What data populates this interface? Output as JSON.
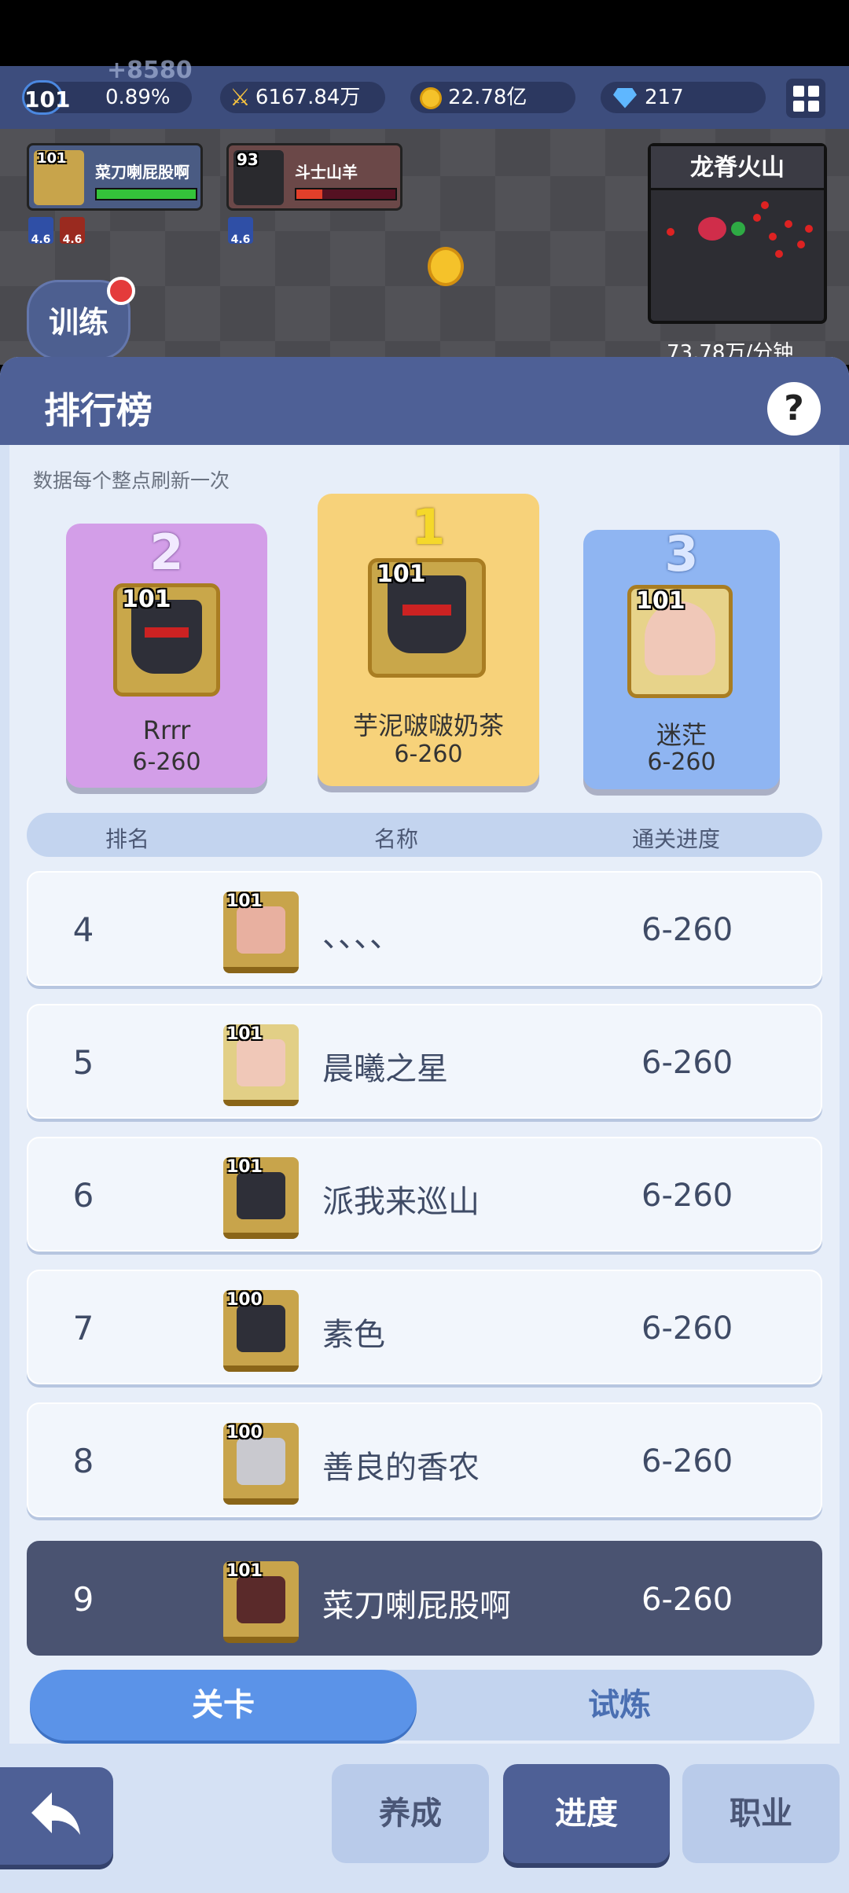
{
  "hud": {
    "level": "101",
    "float_gain": "+8580",
    "exp_percent": "0.89%",
    "power": "6167.84万",
    "gold": "22.78亿",
    "gems": "217"
  },
  "battle": {
    "ally_level": "101",
    "ally_name": "菜刀喇屁股啊",
    "enemy_level": "93",
    "enemy_name": "斗士山羊",
    "buffs": [
      "4.6",
      "4.6"
    ],
    "enemy_buff": "4.6",
    "train_label": "训练",
    "map_name": "龙脊火山",
    "rate": "73.78万/分钟"
  },
  "ranking": {
    "title": "排行榜",
    "help": "?",
    "refresh_note": "数据每个整点刷新一次",
    "podium": [
      {
        "rank": "1",
        "level": "101",
        "name": "芋泥啵啵奶茶",
        "progress": "6-260"
      },
      {
        "rank": "2",
        "level": "101",
        "name": "Rrrr",
        "progress": "6-260"
      },
      {
        "rank": "3",
        "level": "101",
        "name": "迷茫",
        "progress": "6-260"
      }
    ],
    "columns": {
      "rank": "排名",
      "name": "名称",
      "progress": "通关进度"
    },
    "rows": [
      {
        "rank": "4",
        "level": "101",
        "name": "、、、、",
        "progress": "6-260"
      },
      {
        "rank": "5",
        "level": "101",
        "name": "晨曦之星",
        "progress": "6-260"
      },
      {
        "rank": "6",
        "level": "101",
        "name": "派我来巡山",
        "progress": "6-260"
      },
      {
        "rank": "7",
        "level": "100",
        "name": "素色",
        "progress": "6-260"
      },
      {
        "rank": "8",
        "level": "100",
        "name": "善良的香农",
        "progress": "6-260"
      }
    ],
    "me": {
      "rank": "9",
      "level": "101",
      "name": "菜刀喇屁股啊",
      "progress": "6-260"
    },
    "tabs": {
      "stage": "关卡",
      "trial": "试炼"
    }
  },
  "nav": {
    "cultivate": "养成",
    "progress": "进度",
    "job": "职业"
  }
}
